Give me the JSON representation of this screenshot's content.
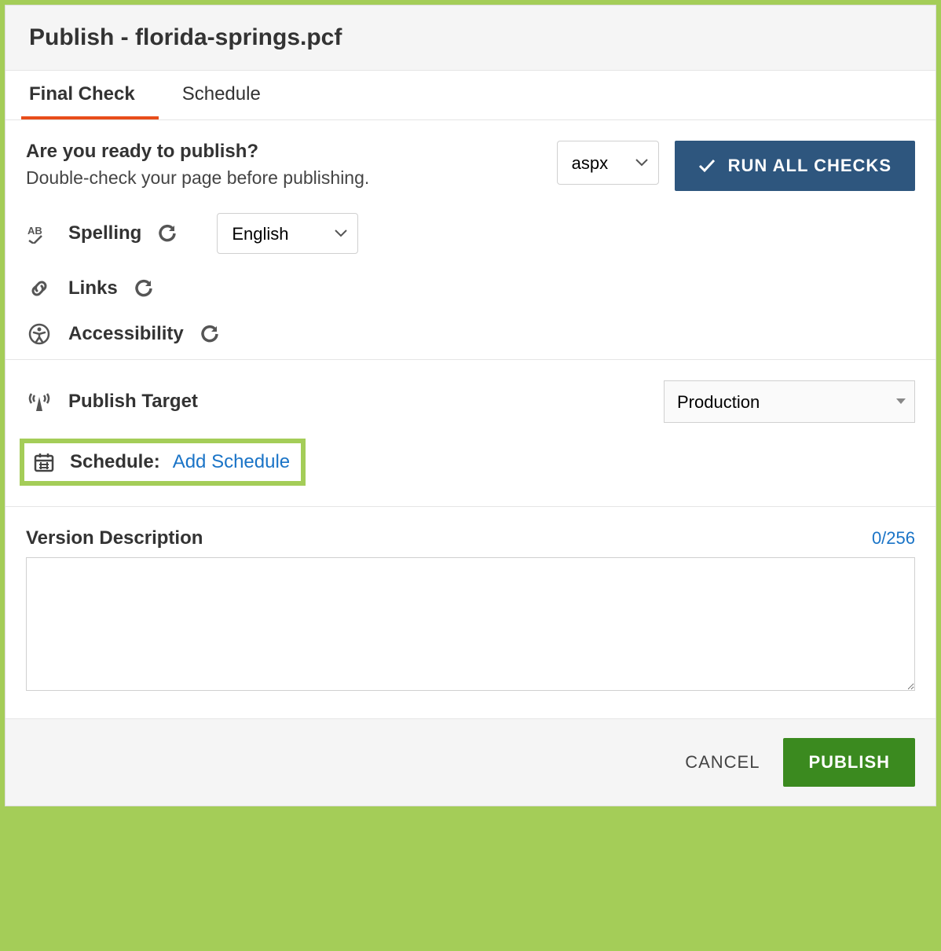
{
  "header": {
    "title": "Publish - florida-springs.pcf"
  },
  "tabs": {
    "final_check": "Final Check",
    "schedule": "Schedule"
  },
  "ready": {
    "question": "Are you ready to publish?",
    "subtext": "Double-check your page before publishing.",
    "extension": "aspx",
    "run_all": "RUN ALL CHECKS"
  },
  "checks": {
    "spelling": {
      "label": "Spelling",
      "language": "English"
    },
    "links": {
      "label": "Links"
    },
    "accessibility": {
      "label": "Accessibility"
    }
  },
  "publish_target": {
    "label": "Publish Target",
    "value": "Production"
  },
  "schedule": {
    "label": "Schedule:",
    "link": "Add Schedule"
  },
  "version_description": {
    "label": "Version Description",
    "count": "0/256",
    "value": ""
  },
  "footer": {
    "cancel": "CANCEL",
    "publish": "PUBLISH"
  }
}
